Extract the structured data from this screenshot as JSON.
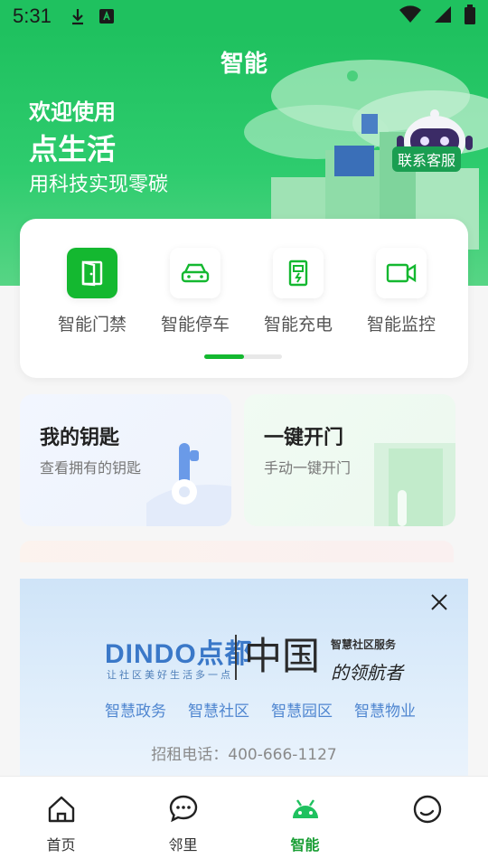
{
  "status_bar": {
    "time": "5:31"
  },
  "header": {
    "title": "智能"
  },
  "hero": {
    "welcome": "欢迎使用",
    "brand": "点生活",
    "slogan": "用科技实现零碳",
    "service_label": "联系客服"
  },
  "functions": [
    {
      "label": "智能门禁",
      "icon": "door-icon",
      "active": true
    },
    {
      "label": "智能停车",
      "icon": "car-icon",
      "active": false
    },
    {
      "label": "智能充电",
      "icon": "charging-pile-icon",
      "active": false
    },
    {
      "label": "智能监控",
      "icon": "camera-icon",
      "active": false
    }
  ],
  "cards": {
    "my_keys": {
      "title": "我的钥匙",
      "subtitle": "查看拥有的钥匙"
    },
    "one_key_open": {
      "title": "一键开门",
      "subtitle": "手动一键开门"
    }
  },
  "ad": {
    "logo": "DINDO点都",
    "logo_sub": "让社区美好生活多一点",
    "china": "中国",
    "service": "智慧社区服务",
    "leader": "的领航者",
    "tags": [
      "智慧政务",
      "智慧社区",
      "智慧园区",
      "智慧物业"
    ],
    "phone": "招租电话：400-666-1127"
  },
  "nav": {
    "items": [
      {
        "label": "首页",
        "icon": "home-icon"
      },
      {
        "label": "邻里",
        "icon": "chat-bubble-icon"
      },
      {
        "label": "智能",
        "icon": "android-icon",
        "active": true
      },
      {
        "label": "",
        "icon": "smiley-icon"
      }
    ]
  },
  "colors": {
    "primary": "#1fc15f",
    "accent": "#14b830",
    "link_blue": "#4f86d0"
  }
}
